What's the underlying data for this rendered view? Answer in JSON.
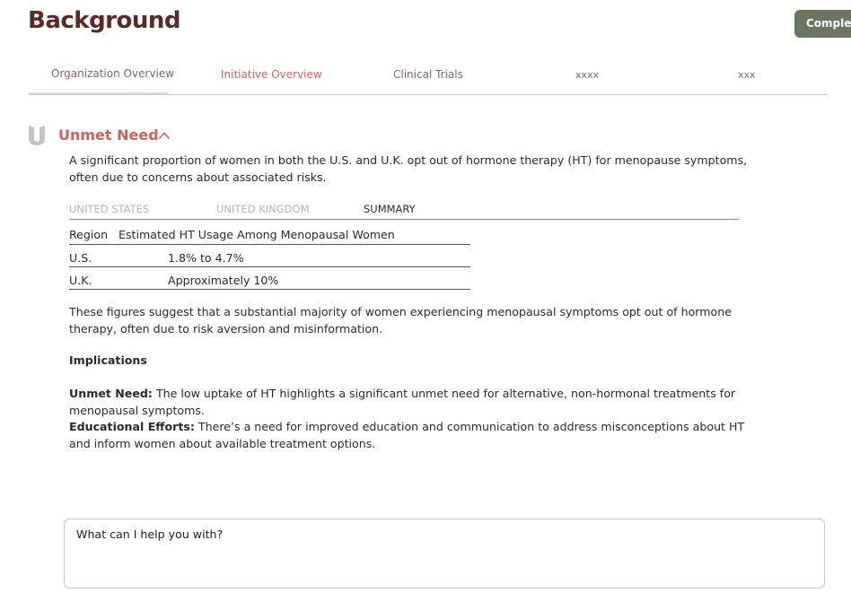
{
  "header": {
    "title": "Background",
    "complete_label": "Complete"
  },
  "tabs": [
    {
      "label": "Organization Overview",
      "active": false
    },
    {
      "label": "Initiative Overview",
      "active": true
    },
    {
      "label": "Clinical Trials",
      "active": false
    },
    {
      "label": "xxxx",
      "active": false
    },
    {
      "label": "xxx",
      "active": false
    }
  ],
  "section": {
    "title": "Unmet Need",
    "icon": "u-shield-icon",
    "intro": "A significant proportion of women in both the U.S. and U.K. opt out of hormone therapy (HT) for menopause symptoms, often due to concerns about associated risks.",
    "subtabs": [
      {
        "label": "UNITED STATES",
        "active": false
      },
      {
        "label": "UNITED KINGDOM",
        "active": false
      },
      {
        "label": "SUMMARY",
        "active": true
      }
    ],
    "table": {
      "headers": [
        "Region",
        "Estimated HT Usage Among Menopausal Women"
      ],
      "rows": [
        [
          "U.S.",
          "1.8% to 4.7%"
        ],
        [
          "U.K.",
          "Approximately 10%"
        ]
      ]
    },
    "summary": "These figures suggest that a substantial majority of women experiencing menopausal symptoms opt out of hormone therapy, often due to risk aversion and misinformation.",
    "implications_heading": "Implications",
    "implications": [
      {
        "label": "Unmet Need:",
        "text": " The low uptake of HT highlights a significant unmet need for alternative, non-hormonal treatments for menopausal symptoms."
      },
      {
        "label": "Educational Efforts:",
        "text": " There’s a need for improved education and communication to address misconceptions about HT and inform women about available treatment options."
      }
    ]
  },
  "chat": {
    "placeholder": "What can I help you with?"
  },
  "colors": {
    "title": "#5a2a24",
    "accent": "#cf6158",
    "button": "#6b7561"
  }
}
